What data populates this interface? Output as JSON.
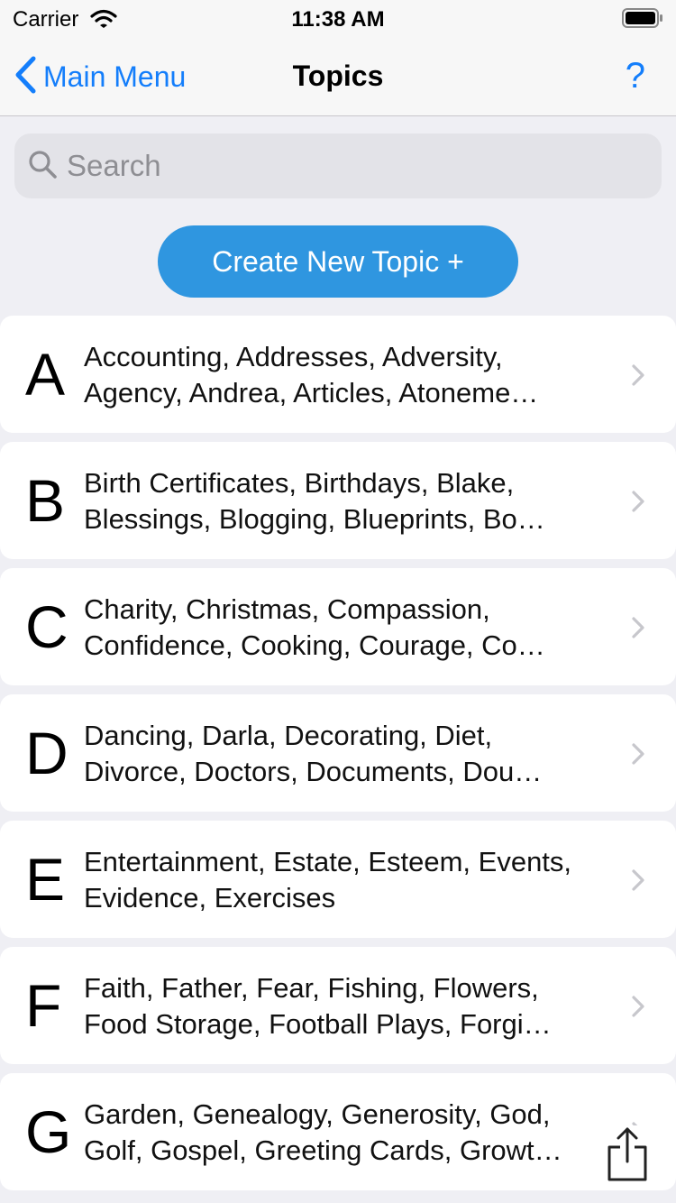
{
  "status": {
    "carrier": "Carrier",
    "time": "11:38 AM"
  },
  "nav": {
    "back_label": "Main Menu",
    "title": "Topics",
    "help_label": "?"
  },
  "search": {
    "placeholder": "Search",
    "value": ""
  },
  "create_button_label": "Create New Topic +",
  "topics": [
    {
      "letter": "A",
      "names": "Accounting, Addresses, Adversity, Agency, Andrea, Articles, Atoneme…"
    },
    {
      "letter": "B",
      "names": "Birth Certificates, Birthdays, Blake, Blessings, Blogging, Blueprints, Bo…"
    },
    {
      "letter": "C",
      "names": "Charity, Christmas, Compassion, Confidence, Cooking, Courage, Co…"
    },
    {
      "letter": "D",
      "names": "Dancing, Darla, Decorating, Diet, Divorce, Doctors, Documents, Dou…"
    },
    {
      "letter": "E",
      "names": "Entertainment, Estate, Esteem, Events, Evidence, Exercises"
    },
    {
      "letter": "F",
      "names": "Faith, Father, Fear, Fishing, Flowers, Food Storage, Football Plays, Forgi…"
    },
    {
      "letter": "G",
      "names": "Garden, Genealogy, Generosity, God, Golf, Gospel, Greeting Cards, Growt…"
    }
  ],
  "colors": {
    "accent": "#147efb",
    "button": "#2f96e0",
    "background": "#efeff4"
  }
}
